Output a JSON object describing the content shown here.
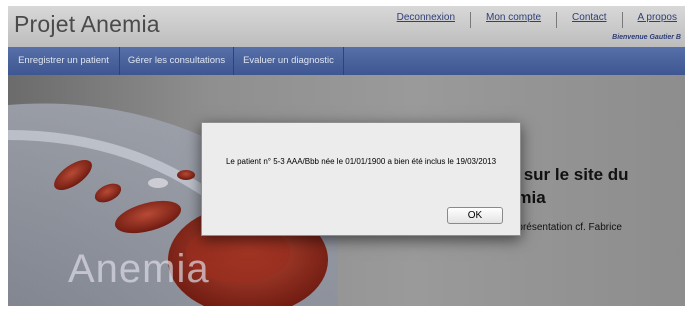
{
  "header": {
    "brand": "Projet Anemia",
    "links": [
      "Deconnexion",
      "Mon compte",
      "Contact",
      "A propos"
    ],
    "welcome": "Bienvenue Gautier B"
  },
  "nav": {
    "items": [
      "Enregistrer un patient",
      "Gérer les consultations",
      "Evaluer un diagnostic"
    ]
  },
  "content": {
    "welcome_title_l1": "Bienvenue sur le site du",
    "welcome_title_l2": "projet Anemia",
    "welcome_text": "Mettre un texte de présentation cf. Fabrice",
    "logo_text": "Anemia"
  },
  "dialog": {
    "message": "Le patient n° 5-3 AAA/Bbb née le 01/01/1900 a bien été inclus le 19/03/2013",
    "ok_label": "OK"
  },
  "colors": {
    "nav": "#4a62a0",
    "link": "#2f3f78",
    "blood": "#8a2418"
  }
}
